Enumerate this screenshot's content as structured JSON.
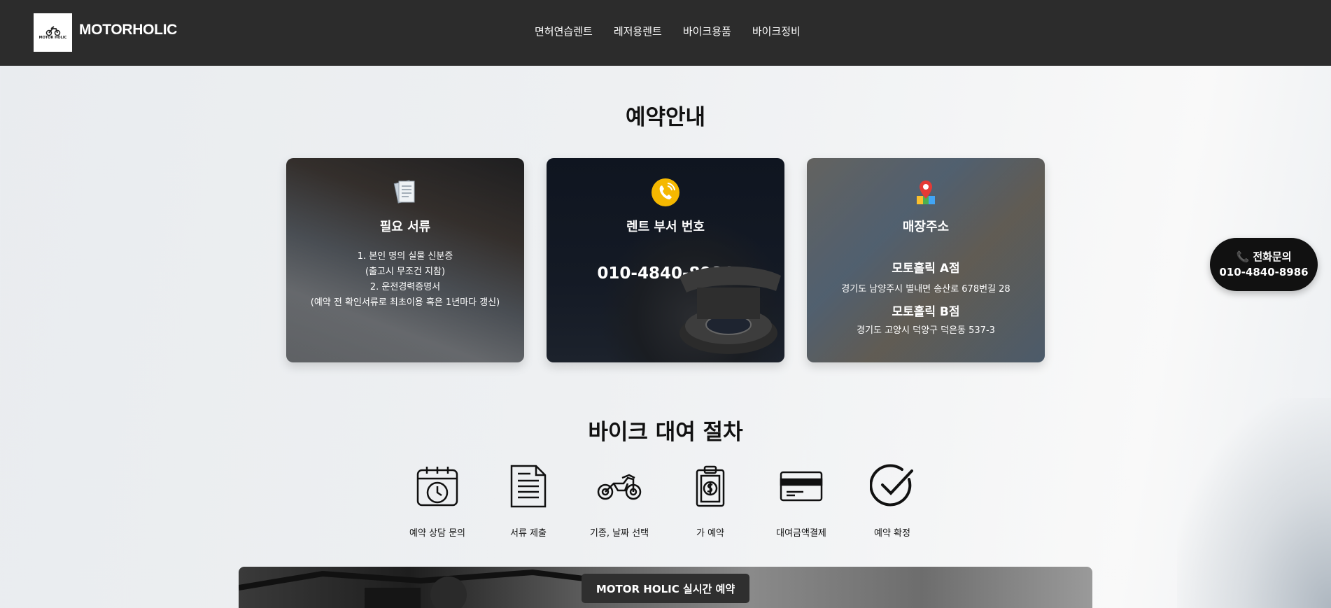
{
  "header": {
    "brand": "MOTORHOLIC",
    "logo_text": "MOTOR HOLIC",
    "nav": [
      "면허연습렌트",
      "레저용렌트",
      "바이크용품",
      "바이크정비"
    ]
  },
  "reservation": {
    "title": "예약안내",
    "cards": {
      "documents": {
        "icon": "documents-icon",
        "title": "필요 서류",
        "lines": [
          "1. 본인 명의 실물 신분증",
          "(출고시 무조건 지참)",
          "2. 운전경력증명서",
          "(예약 전 확인서류로 최초이용 혹은 1년마다 갱신)"
        ]
      },
      "phone": {
        "icon": "phone-icon",
        "title": "렌트 부서 번호",
        "number": "010-4840-8986"
      },
      "stores": {
        "icon": "map-pin-icon",
        "title": "매장주소",
        "store_a_name": "모토홀릭 A점",
        "store_a_address": "경기도 남양주시 별내면 송산로 678번길 28",
        "store_b_name": "모토홀릭 B점",
        "store_b_address": "경기도 고양시 덕양구 덕은동 537-3"
      }
    }
  },
  "floating_call": {
    "label": "📞 전화문의",
    "number": "010-4840-8986"
  },
  "procedure": {
    "title": "바이크 대여 절차",
    "steps": [
      {
        "icon": "calendar-clock-icon",
        "label": "예약 상담 문의"
      },
      {
        "icon": "document-icon",
        "label": "서류 제출"
      },
      {
        "icon": "motorcycle-icon",
        "label": "기종, 날짜 선택"
      },
      {
        "icon": "payment-clipboard-icon",
        "label": "가 예약"
      },
      {
        "icon": "credit-card-icon",
        "label": "대여금액결제"
      },
      {
        "icon": "checkmark-icon",
        "label": "예약 확정"
      }
    ]
  },
  "banner": {
    "button_label": "MOTOR HOLIC 실시간 예약"
  },
  "colors": {
    "header_bg": "#2c2c2c",
    "accent_yellow": "#f5b800",
    "pin_red": "#e53935"
  }
}
